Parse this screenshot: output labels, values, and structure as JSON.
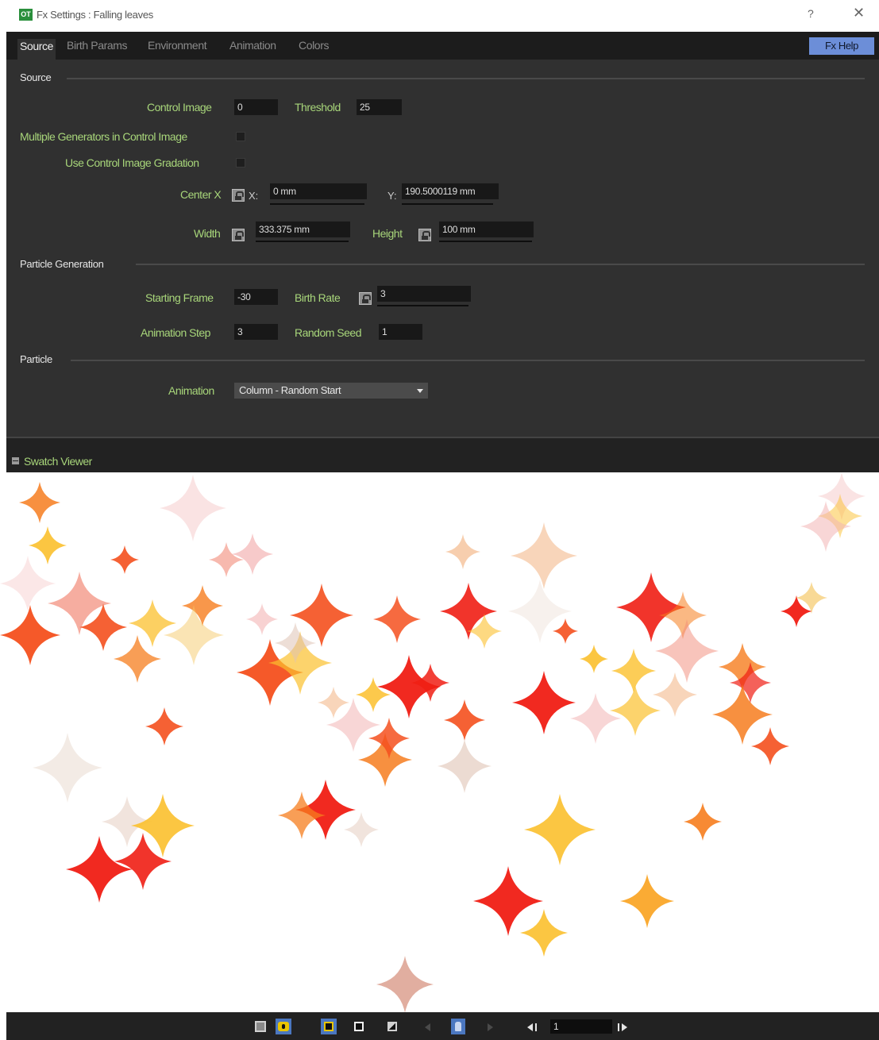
{
  "window": {
    "icon_label": "OT",
    "title": "Fx Settings : Falling leaves",
    "help_symbol": "?",
    "close_symbol": "✕"
  },
  "tabs": [
    {
      "label": "Source",
      "active": true
    },
    {
      "label": "Birth Params",
      "active": false
    },
    {
      "label": "Environment",
      "active": false
    },
    {
      "label": "Animation",
      "active": false
    },
    {
      "label": "Colors",
      "active": false
    }
  ],
  "fx_help_label": "Fx Help",
  "source": {
    "section_title": "Source",
    "control_image": {
      "label": "Control Image",
      "value": "0"
    },
    "threshold": {
      "label": "Threshold",
      "value": "25"
    },
    "multiple_generators": {
      "label": "Multiple Generators in Control Image",
      "checked": false
    },
    "use_gradation": {
      "label": "Use Control Image Gradation",
      "checked": false
    },
    "center": {
      "label": "Center X",
      "x_label": "X:",
      "x_value": "0 mm",
      "y_label": "Y:",
      "y_value": "190.5000119 mm"
    },
    "width": {
      "label": "Width",
      "value": "333.375 mm"
    },
    "height": {
      "label": "Height",
      "value": "100 mm"
    }
  },
  "particle_generation": {
    "section_title": "Particle Generation",
    "starting_frame": {
      "label": "Starting Frame",
      "value": "-30"
    },
    "birth_rate": {
      "label": "Birth Rate",
      "value": "3"
    },
    "animation_step": {
      "label": "Animation Step",
      "value": "3"
    },
    "random_seed": {
      "label": "Random Seed",
      "value": "1"
    }
  },
  "particle": {
    "section_title": "Particle",
    "animation": {
      "label": "Animation",
      "value": "Column - Random Start"
    }
  },
  "swatch_viewer": {
    "label": "Swatch Viewer"
  },
  "bottom_toolbar": {
    "frame_value": "1"
  },
  "palette": {
    "red": "#f01e14",
    "orange_red": "#f4501e",
    "orange": "#f67d1e",
    "amber": "#f9a21e",
    "yellow": "#fbc02d",
    "pale_yellow": "#f5c96a",
    "peach": "#f4b98c",
    "salmon": "#f28a78",
    "pink": "#f3b4b4",
    "pale_pink": "#f7d0d0",
    "tan": "#dfc3b4",
    "beige": "#e8d8cc",
    "rose_tan": "#d99a88"
  }
}
